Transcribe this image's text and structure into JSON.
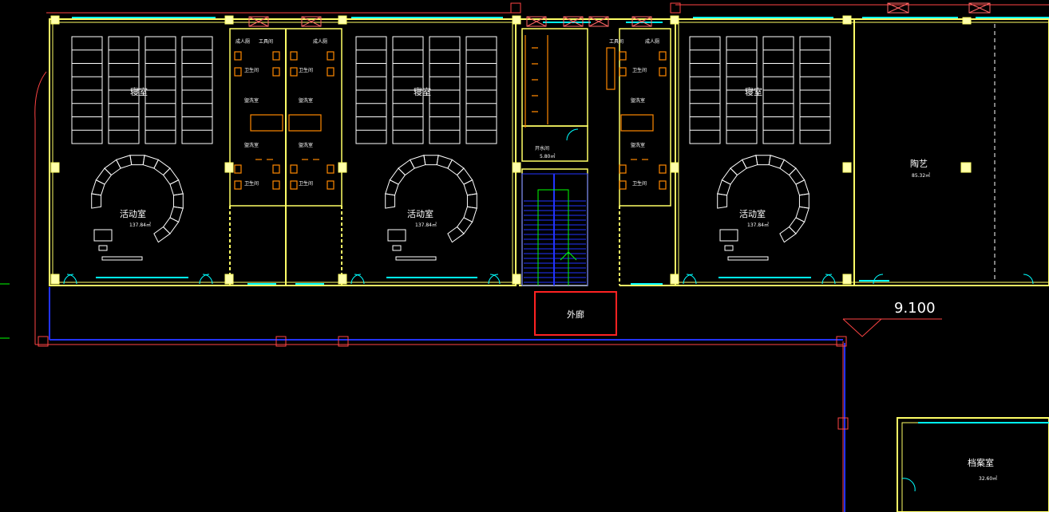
{
  "rooms": {
    "bedroom_1": "寝室",
    "bedroom_2": "寝室",
    "bedroom_3": "寝室",
    "activity_1": "活动室",
    "activity_1_area": "137.84㎡",
    "activity_2": "活动室",
    "activity_2_area": "137.84㎡",
    "activity_3": "活动室",
    "activity_3_area": "137.84㎡",
    "restroom_a1": "卫生间",
    "restroom_a2": "卫生间",
    "restroom_b1": "卫生间",
    "restroom_b2": "卫生间",
    "restroom_c1": "卫生间",
    "restroom_c2": "卫生间",
    "washroom_a1": "盥洗室",
    "washroom_a2": "盥洗室",
    "washroom_b1": "盥洗室",
    "washroom_b2": "盥洗室",
    "washroom_c1": "盥洗室",
    "washroom_c2": "盥洗室",
    "tool_a": "工具间",
    "tool_b": "工具间",
    "teacher_a": "成人厕",
    "teacher_b": "成人厕",
    "teacher_c": "成人厕",
    "water_room": "开水间",
    "water_room_area": "5.80㎡",
    "pottery": "陶艺",
    "pottery_area": "85.32㎡",
    "archive": "档案室",
    "archive_area": "32.60㎡"
  },
  "corridor_label": "外廊",
  "elevation": "9.100",
  "colors": {
    "wall": "#ffff66",
    "axis": "#ff4444",
    "window": "#00ffff",
    "fixture": "#ff8800",
    "stair": "#2233ff",
    "stair_arrow": "#00ff00",
    "furniture": "#ffffff",
    "highlight": "#ff2222"
  }
}
